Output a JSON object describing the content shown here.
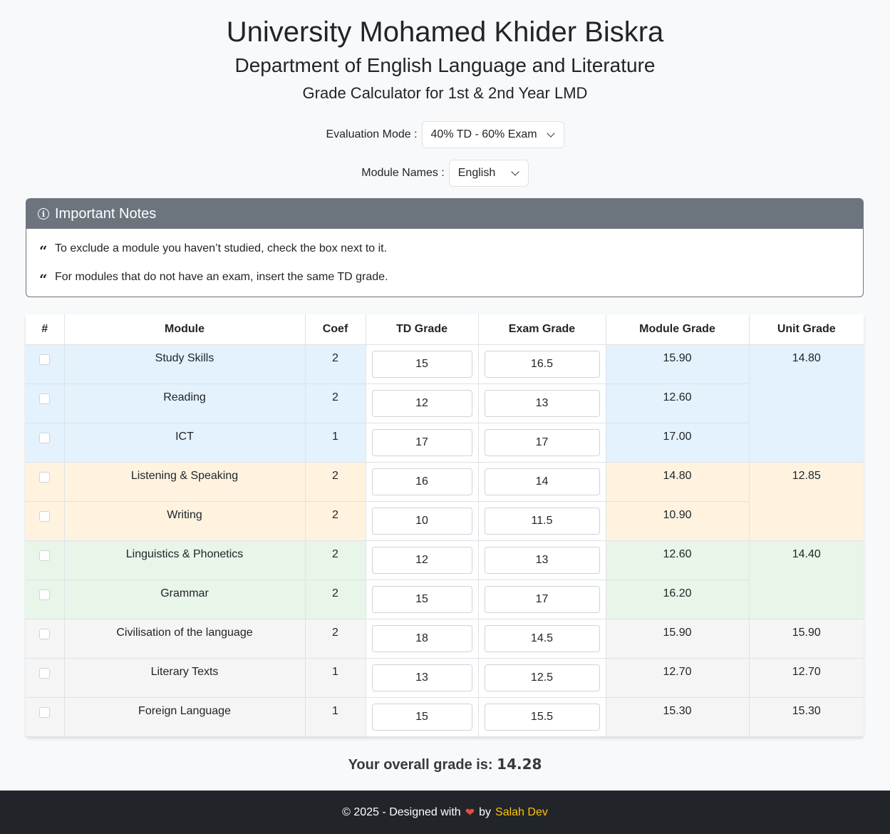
{
  "header": {
    "title": "University Mohamed Khider Biskra",
    "subtitle": "Department of English Language and Literature",
    "subtitle2": "Grade Calculator for 1st & 2nd Year LMD"
  },
  "controls": {
    "mode_label": "Evaluation Mode :",
    "mode_value": "40% TD - 60% Exam",
    "names_label": "Module Names :",
    "names_value": "English"
  },
  "notes": {
    "title": "Important Notes",
    "items": [
      "To exclude a module you haven’t studied, check the box next to it.",
      "For modules that do not have an exam, insert the same TD grade."
    ]
  },
  "table": {
    "headers": [
      "#",
      "Module",
      "Coef",
      "TD Grade",
      "Exam Grade",
      "Module Grade",
      "Unit Grade"
    ],
    "rows": [
      {
        "module": "Study Skills",
        "coef": "2",
        "td": "15",
        "exam": "16.5",
        "grade": "15.90",
        "unit": "14.80"
      },
      {
        "module": "Reading",
        "coef": "2",
        "td": "12",
        "exam": "13",
        "grade": "12.60"
      },
      {
        "module": "ICT",
        "coef": "1",
        "td": "17",
        "exam": "17",
        "grade": "17.00"
      },
      {
        "module": "Listening & Speaking",
        "coef": "2",
        "td": "16",
        "exam": "14",
        "grade": "14.80",
        "unit": "12.85"
      },
      {
        "module": "Writing",
        "coef": "2",
        "td": "10",
        "exam": "11.5",
        "grade": "10.90"
      },
      {
        "module": "Linguistics & Phonetics",
        "coef": "2",
        "td": "12",
        "exam": "13",
        "grade": "12.60",
        "unit": "14.40"
      },
      {
        "module": "Grammar",
        "coef": "2",
        "td": "15",
        "exam": "17",
        "grade": "16.20"
      },
      {
        "module": "Civilisation of the language",
        "coef": "2",
        "td": "18",
        "exam": "14.5",
        "grade": "15.90",
        "unit": "15.90"
      },
      {
        "module": "Literary Texts",
        "coef": "1",
        "td": "13",
        "exam": "12.5",
        "grade": "12.70",
        "unit": "12.70"
      },
      {
        "module": "Foreign Language",
        "coef": "1",
        "td": "15",
        "exam": "15.5",
        "grade": "15.30",
        "unit": "15.30"
      }
    ]
  },
  "overall": {
    "label": "Your overall grade is:",
    "value": "14.28"
  },
  "footer": {
    "prefix": "© 2025 - Designed with",
    "by": "by",
    "author": "Salah Dev"
  },
  "colors": {
    "unit1": "#e3f2fd",
    "unit2": "#fff3e0",
    "unit3": "#e8f5e9",
    "unit4": "#f5f5f5",
    "notes_header": "#6c757d",
    "footer_bg": "#212529",
    "author": "#ffc107",
    "heart": "#e74c3c"
  },
  "icons": {
    "notes": "info-icon",
    "note_item": "quote-icon",
    "heart": "heart-icon",
    "select": "chevron-down-icon"
  }
}
